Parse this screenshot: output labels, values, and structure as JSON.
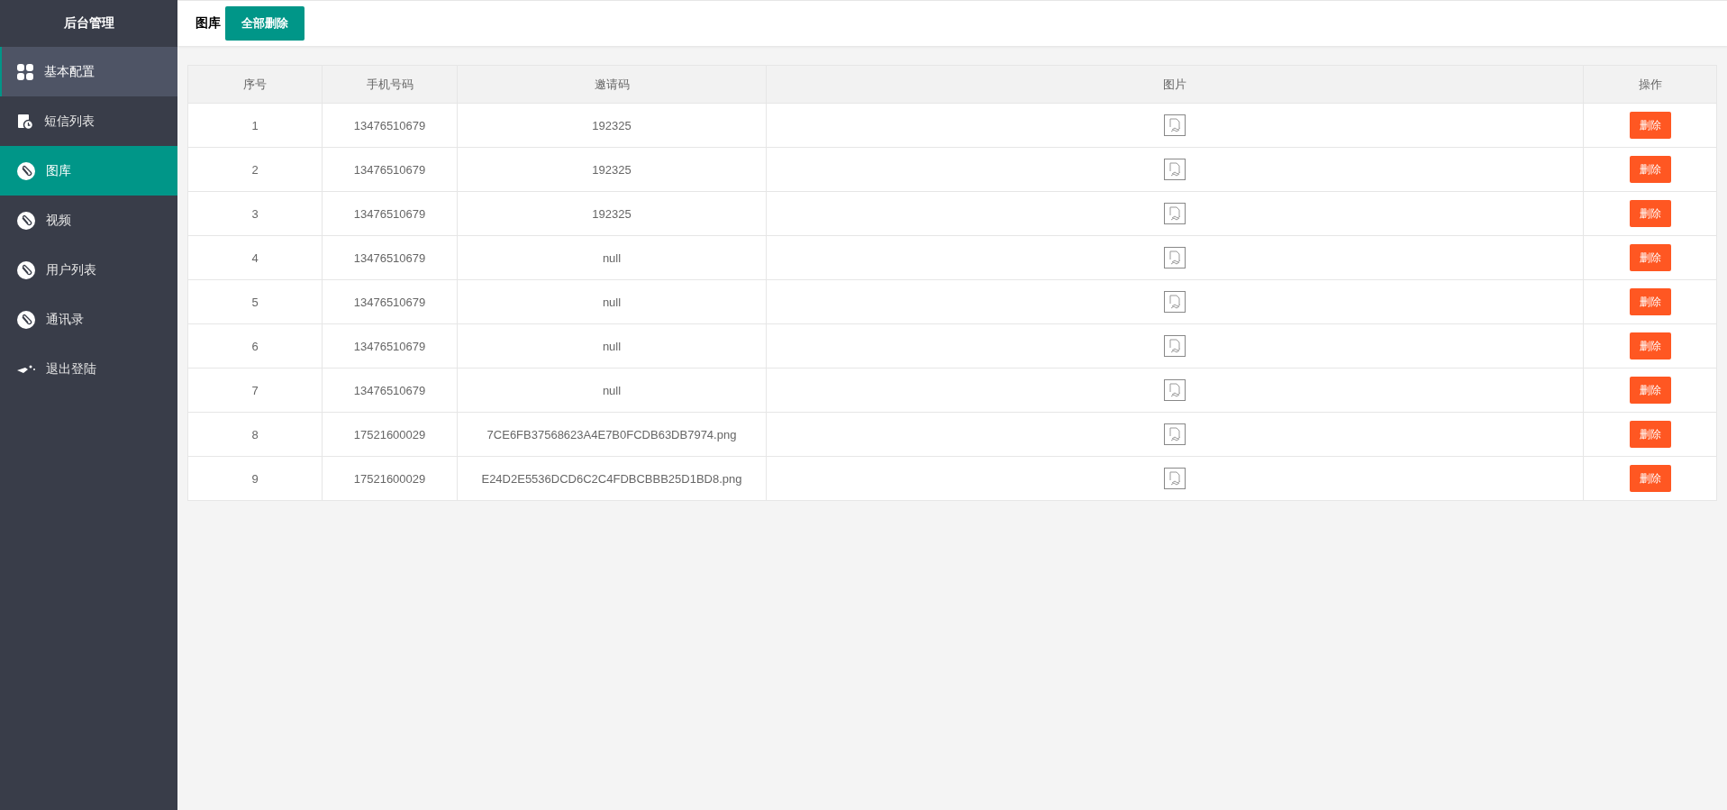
{
  "sidebar": {
    "title": "后台管理",
    "items": [
      {
        "label": "基本配置",
        "kind": "grid",
        "selected": false,
        "hovered": true
      },
      {
        "label": "短信列表",
        "kind": "sms",
        "selected": false,
        "hovered": false
      },
      {
        "label": "图库",
        "kind": "link",
        "selected": true,
        "hovered": false
      },
      {
        "label": "视频",
        "kind": "link",
        "selected": false,
        "hovered": false
      },
      {
        "label": "用户列表",
        "kind": "link",
        "selected": false,
        "hovered": false
      },
      {
        "label": "通讯录",
        "kind": "link",
        "selected": false,
        "hovered": false
      },
      {
        "label": "退出登陆",
        "kind": "logout",
        "selected": false,
        "hovered": false
      }
    ]
  },
  "header": {
    "title": "图库",
    "button": "全部删除"
  },
  "table": {
    "columns": [
      "序号",
      "手机号码",
      "邀请码",
      "图片",
      "操作"
    ],
    "rows": [
      {
        "index": "1",
        "phone": "13476510679",
        "code": "192325",
        "action": "删除"
      },
      {
        "index": "2",
        "phone": "13476510679",
        "code": "192325",
        "action": "删除"
      },
      {
        "index": "3",
        "phone": "13476510679",
        "code": "192325",
        "action": "删除"
      },
      {
        "index": "4",
        "phone": "13476510679",
        "code": "null",
        "action": "删除"
      },
      {
        "index": "5",
        "phone": "13476510679",
        "code": "null",
        "action": "删除"
      },
      {
        "index": "6",
        "phone": "13476510679",
        "code": "null",
        "action": "删除"
      },
      {
        "index": "7",
        "phone": "13476510679",
        "code": "null",
        "action": "删除"
      },
      {
        "index": "8",
        "phone": "17521600029",
        "code": "7CE6FB37568623A4E7B0FCDB63DB7974.png",
        "action": "删除"
      },
      {
        "index": "9",
        "phone": "17521600029",
        "code": "E24D2E5536DCD6C2C4FDBCBBB25D1BD8.png",
        "action": "删除"
      }
    ]
  }
}
